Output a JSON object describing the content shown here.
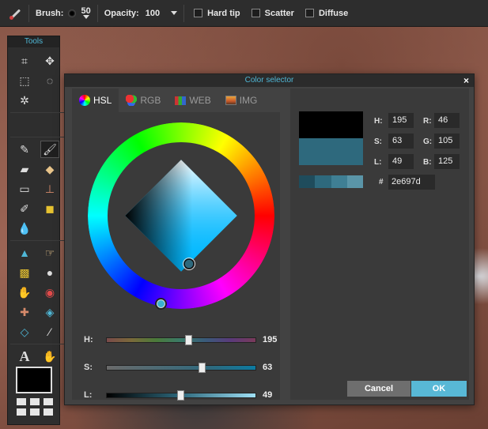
{
  "toolbar": {
    "brush_label": "Brush:",
    "brush_size": "50",
    "opacity_label": "Opacity:",
    "opacity_value": "100",
    "hard_tip": "Hard tip",
    "scatter": "Scatter",
    "diffuse": "Diffuse"
  },
  "tools": {
    "title": "Tools",
    "items": [
      "crop-icon",
      "move-icon",
      "marquee-icon",
      "lasso-icon",
      "magic-wand-icon",
      "",
      "pencil-icon",
      "brush-icon",
      "eraser-icon",
      "fill-bucket-icon",
      "gradient-icon",
      "stamp-icon",
      "color-replace-icon",
      "shapes-icon",
      "blur-drop-icon",
      "sharpen-icon",
      "smudge-icon",
      "sponge-icon",
      "dodge-icon",
      "burn-icon",
      "red-eye-icon",
      "spot-heal-icon",
      "bloat-icon",
      "pinch-icon",
      "color-picker-icon",
      "text-icon",
      "hand-icon",
      "zoom-icon"
    ],
    "active": "brush-icon",
    "foreground_color": "#000000"
  },
  "dialog": {
    "title": "Color selector",
    "close": "×",
    "tabs": [
      {
        "label": "HSL",
        "icon": "hsl-icon"
      },
      {
        "label": "RGB",
        "icon": "rgb-icon"
      },
      {
        "label": "WEB",
        "icon": "web-icon"
      },
      {
        "label": "IMG",
        "icon": "img-icon"
      }
    ],
    "active_tab": "HSL",
    "sliders": [
      {
        "label": "H:",
        "value": "195",
        "fraction": 0.54
      },
      {
        "label": "S:",
        "value": "63",
        "fraction": 0.63
      },
      {
        "label": "L:",
        "value": "49",
        "fraction": 0.49
      }
    ],
    "fields": {
      "h_label": "H:",
      "h": "195",
      "s_label": "S:",
      "s": "63",
      "l_label": "L:",
      "l": "49",
      "r_label": "R:",
      "r": "46",
      "g_label": "G:",
      "g": "105",
      "b_label": "B:",
      "b": "125",
      "hash": "#",
      "hex": "2e697d"
    },
    "colors": {
      "new": "#000000",
      "current": "#2e697d",
      "shades": [
        "#1f4c5c",
        "#2e697d",
        "#3f7f94",
        "#5a95a8"
      ]
    },
    "cancel": "Cancel",
    "ok": "OK"
  }
}
